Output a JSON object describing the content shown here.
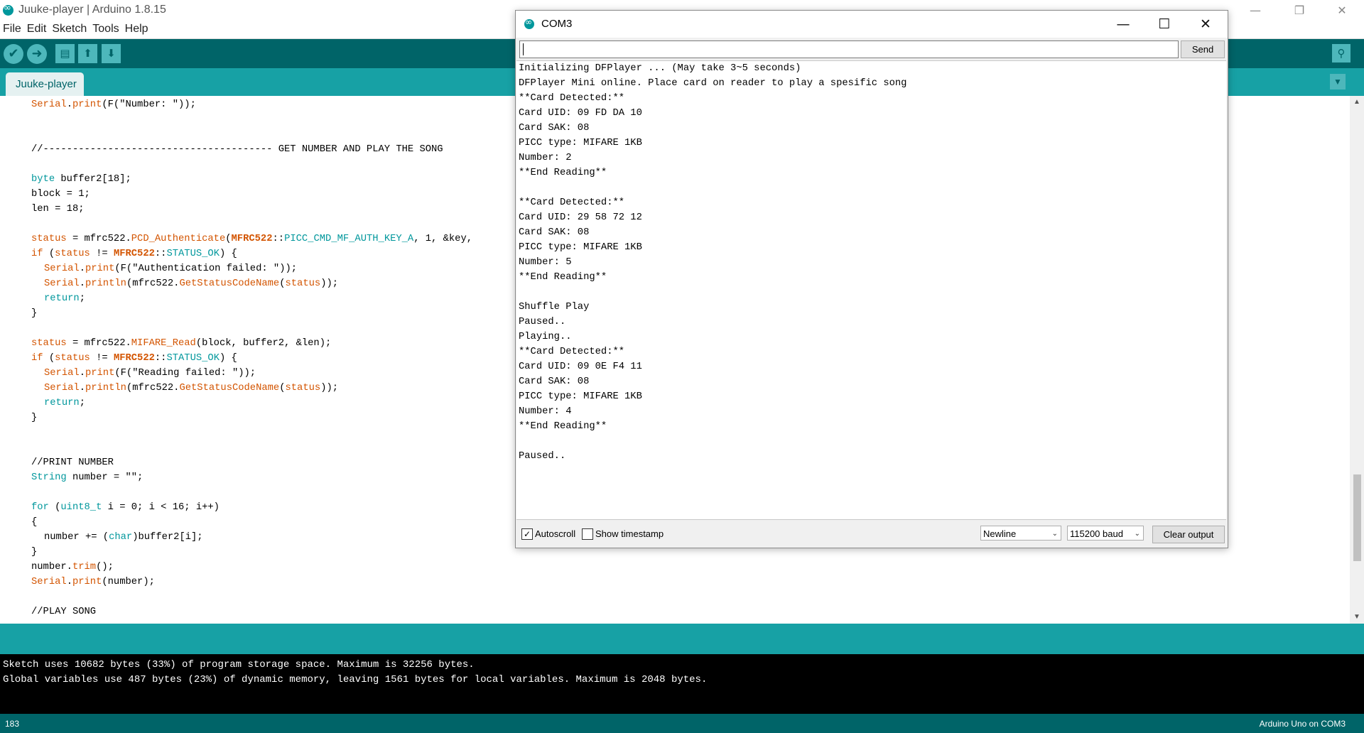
{
  "window": {
    "title": "Juuke-player | Arduino 1.8.15",
    "minimize_glyph": "—",
    "restore_glyph": "❐",
    "close_glyph": "✕"
  },
  "menu": [
    "File",
    "Edit",
    "Sketch",
    "Tools",
    "Help"
  ],
  "toolbar": {
    "verify": "verify-icon",
    "upload": "upload-arrow-icon",
    "new": "new-file-icon",
    "open": "open-arrow-up-icon",
    "save": "save-arrow-down-icon",
    "serial_monitor": "magnifier-icon"
  },
  "tabs": {
    "active": "Juuke-player"
  },
  "colors": {
    "teal_dark": "#006468",
    "teal_mid": "#17a1a5",
    "keyword": "#d35400",
    "type": "#00979c"
  },
  "code": {
    "l1": {
      "a": "Serial",
      "b": ".",
      "c": "print",
      "d": "(F(\"Number: \"));"
    },
    "l2": {
      "a": "//--------------------------------------- GET NUMBER AND PLAY THE SONG"
    },
    "l3": {
      "a": "byte",
      "b": " buffer2[18];"
    },
    "l4": {
      "a": "block = 1;"
    },
    "l5": {
      "a": "len = 18;"
    },
    "l6": {
      "a": "status",
      "b": " = mfrc522.",
      "c": "PCD_Authenticate",
      "d": "(",
      "e": "MFRC522",
      "f": "::",
      "g": "PICC_CMD_MF_AUTH_KEY_A",
      "h": ", 1, &key,"
    },
    "l7": {
      "a": "if",
      "b": " (",
      "c": "status",
      "d": " != ",
      "e": "MFRC522",
      "f": "::",
      "g": "STATUS_OK",
      "h": ") {"
    },
    "l8": {
      "a": "Serial",
      "b": ".",
      "c": "print",
      "d": "(F(\"Authentication failed: \"));"
    },
    "l9": {
      "a": "Serial",
      "b": ".",
      "c": "println",
      "d": "(mfrc522.",
      "e": "GetStatusCodeName",
      "f": "(",
      "g": "status",
      "h": "));"
    },
    "l10": {
      "a": "return",
      "b": ";"
    },
    "l11": {
      "a": "}"
    },
    "l12": {
      "a": "status",
      "b": " = mfrc522.",
      "c": "MIFARE_Read",
      "d": "(block, buffer2, &len);"
    },
    "l13": {
      "a": "if",
      "b": " (",
      "c": "status",
      "d": " != ",
      "e": "MFRC522",
      "f": "::",
      "g": "STATUS_OK",
      "h": ") {"
    },
    "l14": {
      "a": "Serial",
      "b": ".",
      "c": "print",
      "d": "(F(\"Reading failed: \"));"
    },
    "l15": {
      "a": "Serial",
      "b": ".",
      "c": "println",
      "d": "(mfrc522.",
      "e": "GetStatusCodeName",
      "f": "(",
      "g": "status",
      "h": "));"
    },
    "l16": {
      "a": "return",
      "b": ";"
    },
    "l17": {
      "a": "}"
    },
    "l18": {
      "a": "//PRINT NUMBER"
    },
    "l19": {
      "a": "String",
      "b": " number = \"\";"
    },
    "l20": {
      "a": "for",
      "b": " (",
      "c": "uint8_t",
      "d": " i = 0; i < 16; i++)"
    },
    "l21": {
      "a": "{"
    },
    "l22": {
      "a": "number += (",
      "b": "char",
      "c": ")buffer2[i];"
    },
    "l23": {
      "a": "}"
    },
    "l24": {
      "a": "number.",
      "b": "trim",
      "c": "();"
    },
    "l25": {
      "a": "Serial",
      "b": ".",
      "c": "print",
      "d": "(number);"
    },
    "l26": {
      "a": "//PLAY SONG"
    }
  },
  "console": [
    "Sketch uses 10682 bytes (33%) of program storage space. Maximum is 32256 bytes.",
    "Global variables use 487 bytes (23%) of dynamic memory, leaving 1561 bytes for local variables. Maximum is 2048 bytes."
  ],
  "status": {
    "line": "183",
    "board": "Arduino Uno on COM3"
  },
  "serial_monitor": {
    "title": "COM3",
    "input_value": "",
    "send_label": "Send",
    "output": [
      "Initializing DFPlayer ... (May take 3~5 seconds)",
      "DFPlayer Mini online. Place card on reader to play a spesific song",
      "**Card Detected:**",
      "Card UID: 09 FD DA 10",
      "Card SAK: 08",
      "PICC type: MIFARE 1KB",
      "Number: 2",
      "**End Reading**",
      "",
      "**Card Detected:**",
      "Card UID: 29 58 72 12",
      "Card SAK: 08",
      "PICC type: MIFARE 1KB",
      "Number: 5",
      "**End Reading**",
      "",
      "Shuffle Play",
      "Paused..",
      "Playing..",
      "**Card Detected:**",
      "Card UID: 09 0E F4 11",
      "Card SAK: 08",
      "PICC type: MIFARE 1KB",
      "Number: 4",
      "**End Reading**",
      "",
      "Paused.."
    ],
    "autoscroll": {
      "label": "Autoscroll",
      "checked": true
    },
    "timestamp": {
      "label": "Show timestamp",
      "checked": false
    },
    "line_ending": "Newline",
    "baud": "115200 baud",
    "clear_label": "Clear output",
    "check_glyph": "✓",
    "min_glyph": "—",
    "max_glyph": "☐",
    "close_glyph": "✕"
  }
}
